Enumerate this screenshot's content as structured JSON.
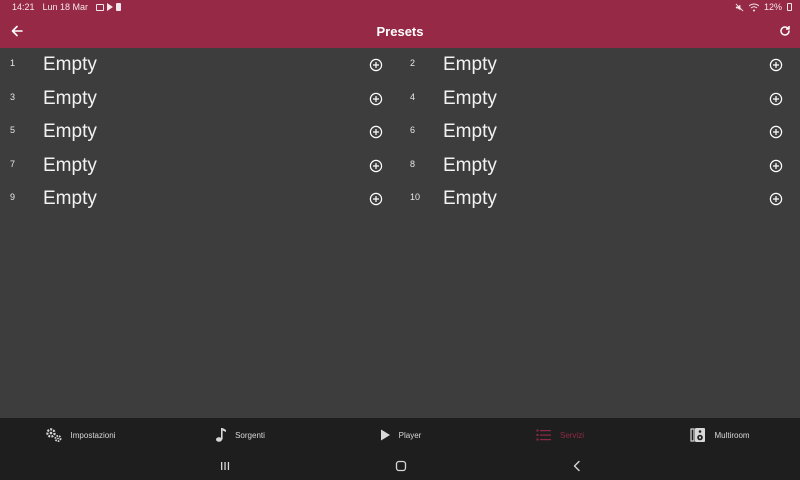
{
  "status_bar": {
    "time": "14:21",
    "date": "Lun 18 Mar",
    "battery": "12%"
  },
  "app_bar": {
    "title": "Presets"
  },
  "presets": [
    {
      "number": "1",
      "label": "Empty"
    },
    {
      "number": "2",
      "label": "Empty"
    },
    {
      "number": "3",
      "label": "Empty"
    },
    {
      "number": "4",
      "label": "Empty"
    },
    {
      "number": "5",
      "label": "Empty"
    },
    {
      "number": "6",
      "label": "Empty"
    },
    {
      "number": "7",
      "label": "Empty"
    },
    {
      "number": "8",
      "label": "Empty"
    },
    {
      "number": "9",
      "label": "Empty"
    },
    {
      "number": "10",
      "label": "Empty"
    }
  ],
  "bottom_nav": {
    "items": [
      {
        "label": "Impostazioni",
        "icon": "gears-icon"
      },
      {
        "label": "Sorgenti",
        "icon": "music-note-icon"
      },
      {
        "label": "Player",
        "icon": "play-icon"
      },
      {
        "label": "Servizi",
        "icon": "list-icon",
        "active": true
      },
      {
        "label": "Multiroom",
        "icon": "speaker-icon"
      }
    ]
  },
  "colors": {
    "primary": "#962a46",
    "background": "#3d3d3d",
    "nav_background": "#1e1e1e",
    "active": "#8f2a45"
  }
}
